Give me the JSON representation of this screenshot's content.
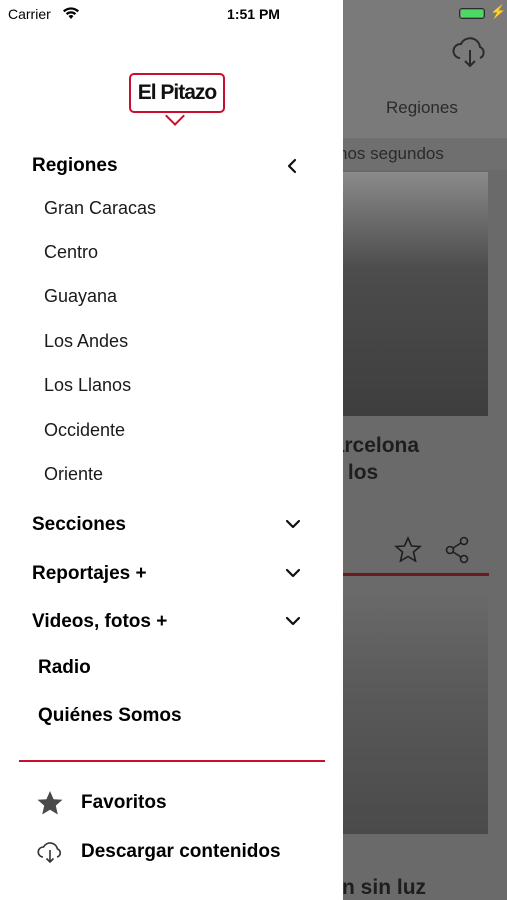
{
  "status_bar": {
    "carrier": "Carrier",
    "time": "1:51 PM"
  },
  "logo": {
    "text": "El Pitazo"
  },
  "menu": {
    "regiones": {
      "label": "Regiones",
      "items": [
        "Gran Caracas",
        "Centro",
        "Guayana",
        "Los Andes",
        "Los Llanos",
        "Occidente",
        "Oriente"
      ]
    },
    "secciones": "Secciones",
    "reportajes": "Reportajes +",
    "videos": "Videos, fotos +",
    "radio": "Radio",
    "quienes": "Quiénes Somos"
  },
  "footer": {
    "favoritos": "Favoritos",
    "descargar": "Descargar contenidos"
  },
  "background": {
    "tab": "Regiones",
    "time_ago": "nos segundos",
    "headline1_line1": "e Barcelona",
    "headline1_line2": "e de los",
    "headline2": "dejan sin luz"
  },
  "colors": {
    "brand_red": "#c8102e",
    "battery_green": "#4cd964"
  },
  "icons": {
    "back": "chevron-left-icon",
    "expand": "chevron-down-icon",
    "favorites": "star-icon",
    "download": "cloud-download-icon"
  }
}
